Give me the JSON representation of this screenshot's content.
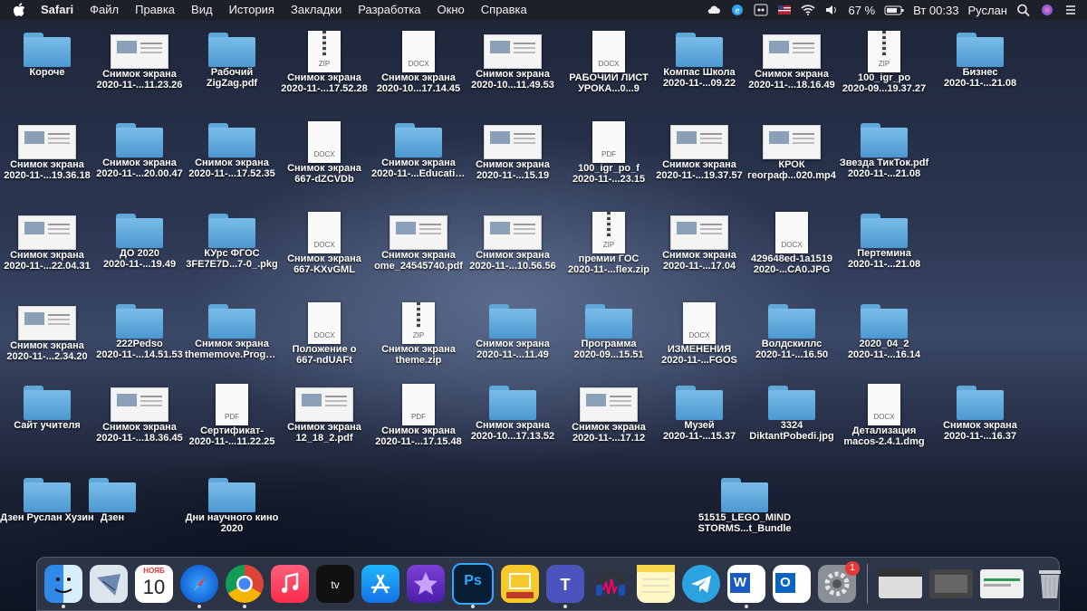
{
  "menubar": {
    "app": "Safari",
    "items": [
      "Файл",
      "Правка",
      "Вид",
      "История",
      "Закладки",
      "Разработка",
      "Окно",
      "Справка"
    ],
    "battery": "67 %",
    "clock": "Вт 00:33",
    "user": "Руслан"
  },
  "desktop": {
    "row1": [
      {
        "type": "folder",
        "label": "Короче"
      },
      {
        "type": "shot",
        "label": "Снимок экрана",
        "sub": "2020-11-...11.23.26"
      },
      {
        "type": "folder",
        "label": "Рабочий",
        "sub": "ZigZag.pdf"
      },
      {
        "type": "zip",
        "label": "Снимок экрана",
        "sub": "2020-11-...17.52.28"
      },
      {
        "type": "docx",
        "label": "Снимок экрана",
        "sub": "2020-10...17.14.45"
      },
      {
        "type": "shot",
        "label": "Снимок экрана",
        "sub": "2020-10...11.49.53"
      },
      {
        "type": "docx",
        "label": "РАБОЧИЙ ЛИСТ",
        "sub": "УРОКА...0...9"
      },
      {
        "type": "folder",
        "label": "Компас Школа",
        "sub": "2020-11-...09.22"
      },
      {
        "type": "shot",
        "label": "Снимок экрана",
        "sub": "2020-11-...18.16.49"
      },
      {
        "type": "zip",
        "label": "100_igr_po",
        "sub": "2020-09...19.37.27"
      },
      {
        "type": "folder",
        "label": "Бизнес",
        "sub": "2020-11-...21.08"
      }
    ],
    "row2": [
      {
        "type": "shot",
        "label": "Снимок экрана",
        "sub": "2020-11-...19.36.18"
      },
      {
        "type": "folder",
        "label": "Снимок экрана",
        "sub": "2020-11-...20.00.47"
      },
      {
        "type": "folder",
        "label": "Снимок экрана",
        "sub": "2020-11-...17.52.35"
      },
      {
        "type": "docx",
        "label": "Снимок экрана",
        "sub": "667-dZCVDb"
      },
      {
        "type": "folder",
        "label": "Снимок экрана",
        "sub": "2020-11-...Education"
      },
      {
        "type": "shot",
        "label": "Снимок экрана",
        "sub": "2020-11-...15.19"
      },
      {
        "type": "pdf",
        "label": "100_igr_po_f",
        "sub": "2020-11-...23.15"
      },
      {
        "type": "shot",
        "label": "Снимок экрана",
        "sub": "2020-11-...19.37.57"
      },
      {
        "type": "shot",
        "label": "КРОК",
        "sub": "географ...020.mp4"
      },
      {
        "type": "folder",
        "label": "Звезда ТикТок.pdf",
        "sub": "2020-11-...21.08"
      }
    ],
    "row3": [
      {
        "type": "shot",
        "label": "Снимок экрана",
        "sub": "2020-11-...22.04.31"
      },
      {
        "type": "folder",
        "label": "ДО 2020",
        "sub": "2020-11-...19.49"
      },
      {
        "type": "folder",
        "label": "КУрс ФГОС",
        "sub": "3FE7E7D...7-0_.pkg"
      },
      {
        "type": "docx",
        "label": "Снимок экрана",
        "sub": "667-KXvGML"
      },
      {
        "type": "shot",
        "label": "Снимок экрана",
        "sub": "ome_24545740.pdf"
      },
      {
        "type": "shot",
        "label": "Снимок экрана",
        "sub": "2020-11-...10.56.56"
      },
      {
        "type": "zip",
        "label": "премии ГОС",
        "sub": "2020-11-...flex.zip"
      },
      {
        "type": "shot",
        "label": "Снимок экрана",
        "sub": "2020-11-...17.04"
      },
      {
        "type": "docx",
        "label": "429648ed-1a1519",
        "sub": "2020-...CA0.JPG"
      },
      {
        "type": "folder",
        "label": "Пертемина",
        "sub": "2020-11-...21.08"
      }
    ],
    "row4": [
      {
        "type": "shot",
        "label": "Снимок экрана",
        "sub": "2020-11-...2.34.20"
      },
      {
        "type": "folder",
        "label": "222Pedso",
        "sub": "2020-11-...14.51.53"
      },
      {
        "type": "folder",
        "label": "Снимок экрана",
        "sub": "thememove.ProgK..."
      },
      {
        "type": "docx",
        "label": "Положение о",
        "sub": "667-ndUAFt"
      },
      {
        "type": "zip",
        "label": "Снимок экрана",
        "sub": "theme.zip"
      },
      {
        "type": "folder",
        "label": "Снимок экрана",
        "sub": "2020-11-...11.49"
      },
      {
        "type": "folder",
        "label": "Программа",
        "sub": "2020-09...15.51"
      },
      {
        "type": "docx",
        "label": "ИЗМЕНЕНИЯ",
        "sub": "2020-11-...FGOS"
      },
      {
        "type": "folder",
        "label": "Волдскиллс",
        "sub": "2020-11-...16.50"
      },
      {
        "type": "folder",
        "label": "2020_04_2",
        "sub": "2020-11-...16.14"
      }
    ],
    "row5": [
      {
        "type": "folder",
        "label": "Сайт учителя"
      },
      {
        "type": "shot",
        "label": "Снимок экрана",
        "sub": "2020-11-...18.36.45"
      },
      {
        "type": "pdf",
        "label": "Сертификат-",
        "sub": "2020-11-...11.22.25"
      },
      {
        "type": "shot",
        "label": "Снимок экрана",
        "sub": "12_18_2.pdf"
      },
      {
        "type": "pdf",
        "label": "Снимок экрана",
        "sub": "2020-11-...17.15.48"
      },
      {
        "type": "folder",
        "label": "Снимок экрана",
        "sub": "2020-10...17.13.52"
      },
      {
        "type": "shot",
        "label": "Снимок экрана",
        "sub": "2020-11-...17.12"
      },
      {
        "type": "folder",
        "label": "Музей",
        "sub": "2020-11-...15.37"
      },
      {
        "type": "folder",
        "label": "3324",
        "sub": "DiktantPobedi.jpg"
      },
      {
        "type": "docx",
        "label": "Детализация",
        "sub": "macos-2.4.1.dmg"
      },
      {
        "type": "folder",
        "label": "Снимок экрана",
        "sub": "2020-11-...16.37"
      }
    ],
    "row6": [
      {
        "type": "folder",
        "label": "Дзен Руслан Хузин"
      },
      {
        "type": "folder",
        "label": "Дзен"
      },
      {
        "type": "folder",
        "label": "Дни научного кино",
        "sub": "2020"
      },
      {
        "type": "folder",
        "label": "51515_LEGO_MIND",
        "sub": "STORMS...t_Bundle"
      }
    ]
  },
  "dock": {
    "apps": [
      "finder-icon",
      "mail-icon",
      "calendar-icon",
      "safari-icon",
      "chrome-icon",
      "music-icon",
      "appletv-icon",
      "appstore-icon",
      "imovie-icon",
      "photoshop-icon",
      "education-icon",
      "teams-icon",
      "audacity-icon",
      "notes-icon",
      "telegram-icon",
      "word-icon",
      "outlook-icon",
      "preferences-icon"
    ],
    "calendar_month": "НОЯБ",
    "calendar_day": "10",
    "prefs_badge": "1",
    "photoshop_label": "Ps",
    "word_label": "W",
    "outlook_label": "O"
  },
  "colors": {
    "folder": "#5fa8d9",
    "menubar": "#1e2028",
    "badge": "#e53935"
  }
}
